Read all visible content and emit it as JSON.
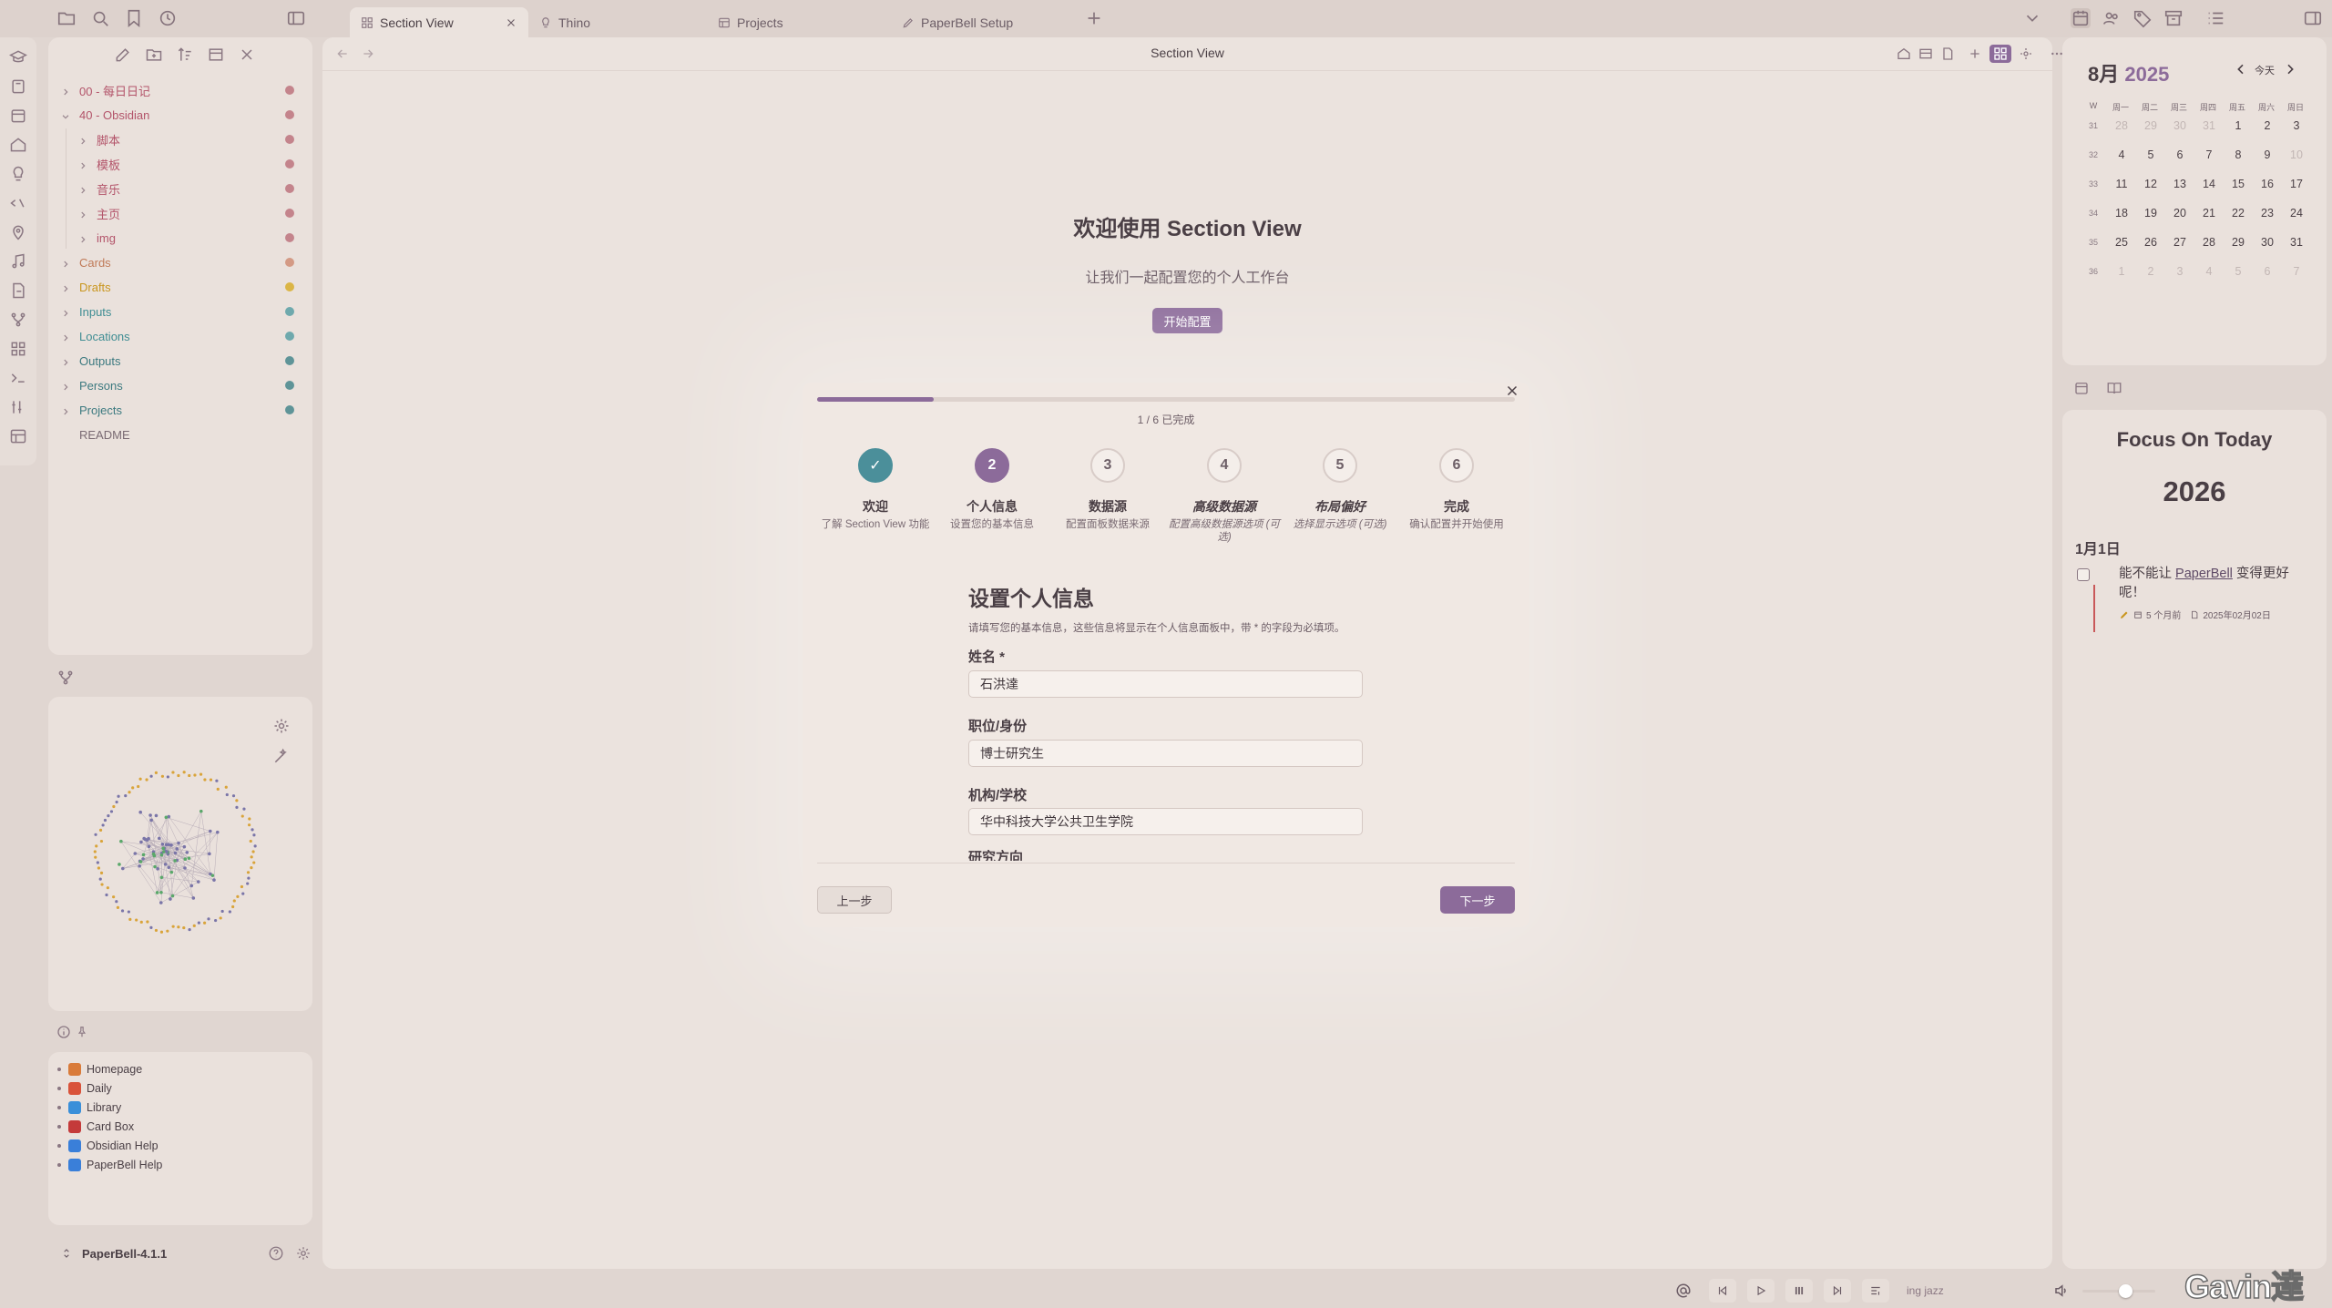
{
  "tabs": [
    {
      "label": "Section View"
    },
    {
      "label": "Thino"
    },
    {
      "label": "Projects"
    },
    {
      "label": "PaperBell Setup"
    }
  ],
  "files": [
    {
      "label": "00 - 每日日记",
      "color": "#b3546a",
      "dot": "#c4848c"
    },
    {
      "label": "40 - Obsidian",
      "color": "#b3546a",
      "dot": "#c4848c"
    },
    {
      "label": "脚本",
      "color": "#b3546a",
      "dot": "#c4848c"
    },
    {
      "label": "模板",
      "color": "#b3546a",
      "dot": "#c4848c"
    },
    {
      "label": "音乐",
      "color": "#b3546a",
      "dot": "#c4848c"
    },
    {
      "label": "主页",
      "color": "#b3546a",
      "dot": "#c4848c"
    },
    {
      "label": "img",
      "color": "#b3546a",
      "dot": "#c4848c"
    },
    {
      "label": "Cards",
      "color": "#c07a58",
      "dot": "#d49a85"
    },
    {
      "label": "Drafts",
      "color": "#c9961e",
      "dot": "#dbb546"
    },
    {
      "label": "Inputs",
      "color": "#3f8d93",
      "dot": "#6fa9ad"
    },
    {
      "label": "Locations",
      "color": "#3f8d93",
      "dot": "#6fa9ad"
    },
    {
      "label": "Outputs",
      "color": "#3d7a80",
      "dot": "#5f9498"
    },
    {
      "label": "Persons",
      "color": "#3d7a80",
      "dot": "#5f9498"
    },
    {
      "label": "Projects",
      "color": "#3d7a80",
      "dot": "#5f9498"
    },
    {
      "label": "README",
      "color": "#7a6b73",
      "dot": ""
    }
  ],
  "bookmarks": [
    {
      "label": "Homepage",
      "color": "#d97b3a"
    },
    {
      "label": "Daily",
      "color": "#d9533a"
    },
    {
      "label": "Library",
      "color": "#3a8fd9"
    },
    {
      "label": "Card Box",
      "color": "#c43a3a"
    },
    {
      "label": "Obsidian Help",
      "color": "#3a7fd9"
    },
    {
      "label": "PaperBell Help",
      "color": "#3a7fd9"
    }
  ],
  "vault": {
    "name": "PaperBell-4.1.1"
  },
  "main": {
    "header_title": "Section View",
    "welcome_title": "欢迎使用 Section View",
    "welcome_subtitle": "让我们一起配置您的个人工作台",
    "start_button": "开始配置"
  },
  "wizard": {
    "progress_text": "1 / 6 已完成",
    "progress_fraction": 0.1667,
    "steps": [
      {
        "num": "✓",
        "title": "欢迎",
        "desc": "了解 Section View 功能"
      },
      {
        "num": "2",
        "title": "个人信息",
        "desc": "设置您的基本信息"
      },
      {
        "num": "3",
        "title": "数据源",
        "desc": "配置面板数据来源"
      },
      {
        "num": "4",
        "title": "高级数据源",
        "desc": "配置高级数据源选项 (可选)"
      },
      {
        "num": "5",
        "title": "布局偏好",
        "desc": "选择显示选项 (可选)"
      },
      {
        "num": "6",
        "title": "完成",
        "desc": "确认配置并开始使用"
      }
    ],
    "section_title": "设置个人信息",
    "section_desc": "请填写您的基本信息，这些信息将显示在个人信息面板中，带 * 的字段为必填项。",
    "fields": [
      {
        "label": "姓名 *",
        "value": "石洪達"
      },
      {
        "label": "职位/身份",
        "value": "博士研究生"
      },
      {
        "label": "机构/学校",
        "value": "华中科技大学公共卫生学院"
      },
      {
        "label": "研究方向",
        "value": ""
      }
    ],
    "prev_button": "上一步",
    "next_button": "下一步"
  },
  "calendar": {
    "month": "8月",
    "year": "2025",
    "today_label": "今天",
    "week_header": "W",
    "day_headers": [
      "周一",
      "周二",
      "周三",
      "周四",
      "周五",
      "周六",
      "周日"
    ],
    "weeks": [
      {
        "w": "31",
        "days": [
          "28",
          "29",
          "30",
          "31",
          "1",
          "2",
          "3"
        ],
        "muted": [
          true,
          true,
          true,
          true,
          false,
          false,
          false
        ]
      },
      {
        "w": "32",
        "days": [
          "4",
          "5",
          "6",
          "7",
          "8",
          "9",
          "10"
        ],
        "muted": [
          false,
          false,
          false,
          false,
          false,
          false,
          true
        ]
      },
      {
        "w": "33",
        "days": [
          "11",
          "12",
          "13",
          "14",
          "15",
          "16",
          "17"
        ],
        "muted": [
          false,
          false,
          false,
          false,
          false,
          false,
          false
        ]
      },
      {
        "w": "34",
        "days": [
          "18",
          "19",
          "20",
          "21",
          "22",
          "23",
          "24"
        ],
        "muted": [
          false,
          false,
          false,
          false,
          false,
          false,
          false
        ]
      },
      {
        "w": "35",
        "days": [
          "25",
          "26",
          "27",
          "28",
          "29",
          "30",
          "31"
        ],
        "muted": [
          false,
          false,
          false,
          false,
          false,
          false,
          false
        ]
      },
      {
        "w": "36",
        "days": [
          "1",
          "2",
          "3",
          "4",
          "5",
          "6",
          "7"
        ],
        "muted": [
          true,
          true,
          true,
          true,
          true,
          true,
          true
        ]
      }
    ]
  },
  "focus": {
    "title": "Focus On Today",
    "year": "2026",
    "date": "1月1日",
    "task_prefix": "能不能让 ",
    "task_link": "PaperBell",
    "task_suffix": " 变得更好呢！",
    "meta_ago": "5 个月前",
    "meta_date": "2025年02月02日"
  },
  "player": {
    "track": "ing jazz"
  },
  "watermark": "Gavin達"
}
